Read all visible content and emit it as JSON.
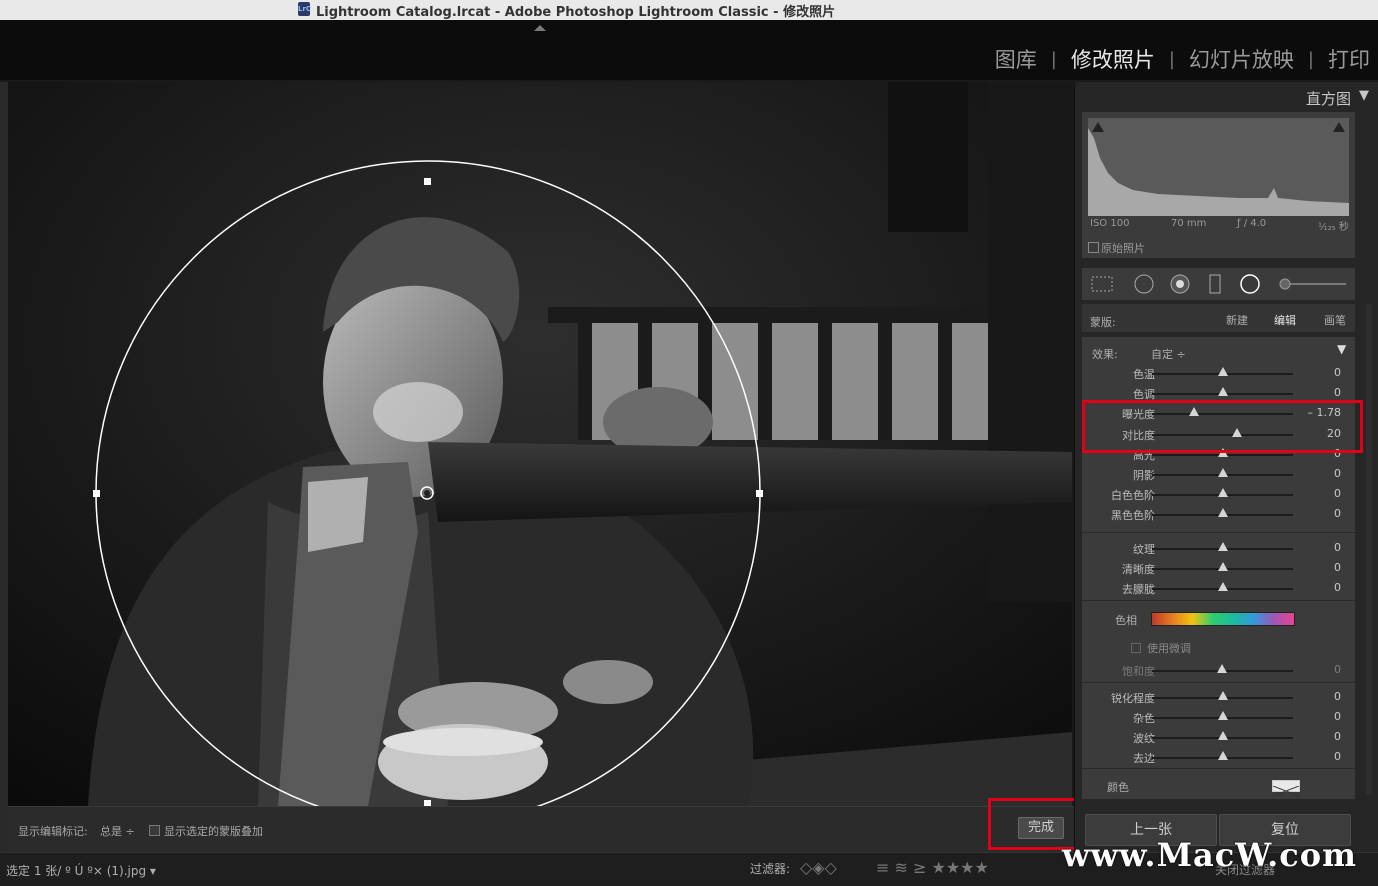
{
  "window": {
    "title": "Lightroom Catalog.lrcat - Adobe Photoshop Lightroom Classic - 修改照片",
    "app_icon_text": "LrC"
  },
  "modules": [
    {
      "label": "图库",
      "active": false
    },
    {
      "label": "修改照片",
      "active": true
    },
    {
      "label": "幻灯片放映",
      "active": false
    },
    {
      "label": "打印",
      "active": false
    }
  ],
  "histogram": {
    "header": "直方图",
    "iso": "ISO 100",
    "focal": "70 mm",
    "aperture": "ƒ / 4.0",
    "shutter": "¹⁄₁₂₅ 秒",
    "original_photo_label": "原始照片"
  },
  "mask": {
    "label": "蒙版:",
    "new": "新建",
    "edit": "编辑",
    "brush": "画笔"
  },
  "effect": {
    "label": "效果:",
    "value": "自定 ÷"
  },
  "sliders_group1": [
    {
      "name": "色温",
      "value": "0",
      "pos": 0.5
    },
    {
      "name": "色调",
      "value": "0",
      "pos": 0.5
    },
    {
      "name": "曝光度",
      "value": "– 1.78",
      "pos": 0.3
    },
    {
      "name": "对比度",
      "value": "20",
      "pos": 0.6
    },
    {
      "name": "高光",
      "value": "0",
      "pos": 0.5
    },
    {
      "name": "阴影",
      "value": "0",
      "pos": 0.5
    },
    {
      "name": "白色色阶",
      "value": "0",
      "pos": 0.5
    },
    {
      "name": "黑色色阶",
      "value": "0",
      "pos": 0.5
    }
  ],
  "sliders_group2": [
    {
      "name": "纹理",
      "value": "0",
      "pos": 0.5
    },
    {
      "name": "清晰度",
      "value": "0",
      "pos": 0.5
    },
    {
      "name": "去朦胧",
      "value": "0",
      "pos": 0.5
    }
  ],
  "hue": {
    "label": "色相",
    "fine_tune_label": "使用微调",
    "saturation_label": "饱和度",
    "saturation_value": "0"
  },
  "sliders_group3": [
    {
      "name": "锐化程度",
      "value": "0",
      "pos": 0.5
    },
    {
      "name": "杂色",
      "value": "0",
      "pos": 0.5
    },
    {
      "name": "波纹",
      "value": "0",
      "pos": 0.5
    },
    {
      "name": "去边",
      "value": "0",
      "pos": 0.5
    }
  ],
  "color_label": "颜色",
  "toolbar": {
    "show_marks_label": "显示编辑标记:",
    "show_marks_value": "总是 ÷",
    "show_overlay_label": "显示选定的蒙版叠加",
    "done_label": "完成"
  },
  "nav": {
    "prev": "上一张",
    "reset": "复位"
  },
  "statusbar": {
    "selection": "选定 1 张/ º Ú º× (1).jpg ▾",
    "filter_label": "过滤器:",
    "filter_off": "关闭过滤器"
  },
  "watermark": "www.MacW.com",
  "colors": {
    "highlight_box": "#e1001a",
    "panel_bg": "#3b3b3b"
  }
}
